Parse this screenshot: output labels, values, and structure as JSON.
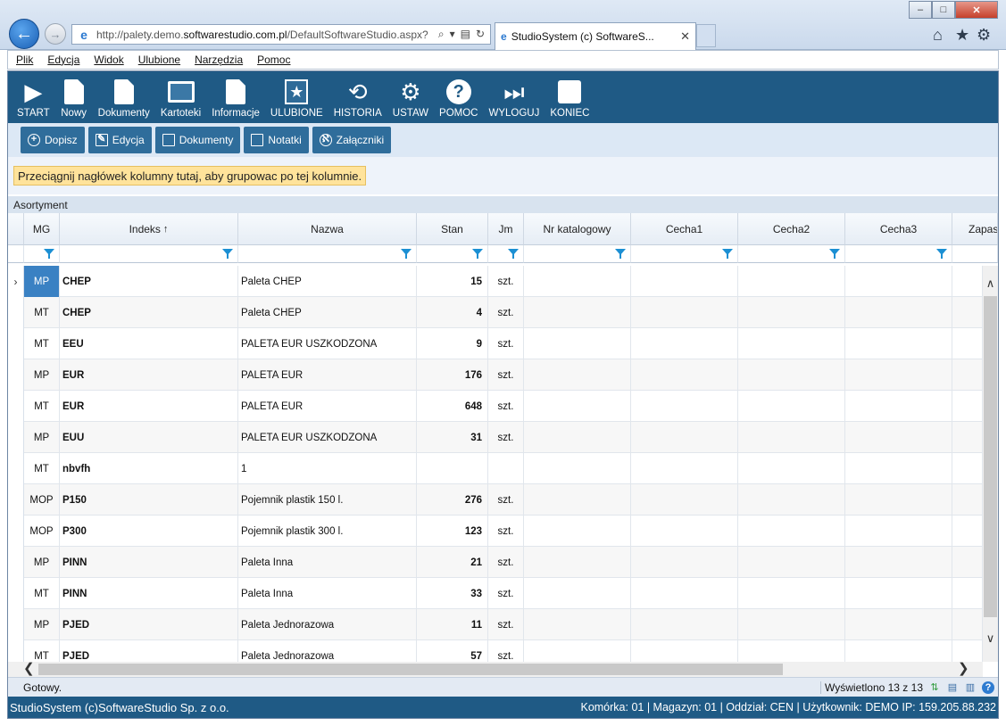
{
  "browser": {
    "url_prefix": "http://paletу.demo.",
    "url_host": "softwarestudio.com.pl",
    "url_path": "/DefaultSoftwareStudio.aspx?",
    "tab_title": "StudioSystem (c) SoftwareS..."
  },
  "menu": [
    "Plik",
    "Edycja",
    "Widok",
    "Ulubione",
    "Narzędzia",
    "Pomoc"
  ],
  "ribbon": [
    {
      "label": "START",
      "icon": "play-icon"
    },
    {
      "label": "Nowy",
      "icon": "new-document-icon"
    },
    {
      "label": "Dokumenty",
      "icon": "documents-icon"
    },
    {
      "label": "Kartoteki",
      "icon": "card-files-icon"
    },
    {
      "label": "Informacje",
      "icon": "info-icon"
    },
    {
      "label": "ULUBIONE",
      "icon": "favorites-icon"
    },
    {
      "label": "HISTORIA",
      "icon": "history-icon"
    },
    {
      "label": "USTAW",
      "icon": "settings-icon"
    },
    {
      "label": "POMOC",
      "icon": "help-icon"
    },
    {
      "label": "WYLOGUJ",
      "icon": "logout-icon"
    },
    {
      "label": "KONIEC",
      "icon": "end-icon"
    }
  ],
  "toolbar": [
    {
      "label": "Dopisz",
      "icon": "add-icon"
    },
    {
      "label": "Edycja",
      "icon": "edit-icon"
    },
    {
      "label": "Dokumenty",
      "icon": "document-icon"
    },
    {
      "label": "Notatki",
      "icon": "notes-icon"
    },
    {
      "label": "Załączniki",
      "icon": "attachment-icon"
    }
  ],
  "group_hint": "Przeciągnij nagłówek kolumny tutaj, aby grupowac po tej kolumnie.",
  "grid": {
    "title": "Asortyment",
    "columns": [
      "MG",
      "Indeks",
      "Nazwa",
      "Stan",
      "Jm",
      "Nr katalogowy",
      "Cecha1",
      "Cecha2",
      "Cecha3",
      "Zapas"
    ],
    "sort_column": "Indeks",
    "sort_direction": "ascending",
    "rows": [
      {
        "mg": "MP",
        "indeks": "CHEP",
        "nazwa": "Paleta CHEP",
        "stan": "15",
        "jm": "szt."
      },
      {
        "mg": "MT",
        "indeks": "CHEP",
        "nazwa": "Paleta CHEP",
        "stan": "4",
        "jm": "szt."
      },
      {
        "mg": "MT",
        "indeks": "EEU",
        "nazwa": "PALETA EUR USZKODZONA",
        "stan": "9",
        "jm": "szt."
      },
      {
        "mg": "MP",
        "indeks": "EUR",
        "nazwa": "PALETA EUR",
        "stan": "176",
        "jm": "szt."
      },
      {
        "mg": "MT",
        "indeks": "EUR",
        "nazwa": "PALETA EUR",
        "stan": "648",
        "jm": "szt."
      },
      {
        "mg": "MP",
        "indeks": "EUU",
        "nazwa": "PALETA EUR USZKODZONA",
        "stan": "31",
        "jm": "szt."
      },
      {
        "mg": "MT",
        "indeks": "nbvfh",
        "nazwa": "1",
        "stan": "",
        "jm": ""
      },
      {
        "mg": "MOP",
        "indeks": "P150",
        "nazwa": "Pojemnik plastik 150 l.",
        "stan": "276",
        "jm": "szt."
      },
      {
        "mg": "MOP",
        "indeks": "P300",
        "nazwa": "Pojemnik plastik 300 l.",
        "stan": "123",
        "jm": "szt."
      },
      {
        "mg": "MP",
        "indeks": "PINN",
        "nazwa": "Paleta Inna",
        "stan": "21",
        "jm": "szt."
      },
      {
        "mg": "MT",
        "indeks": "PINN",
        "nazwa": "Paleta Inna",
        "stan": "33",
        "jm": "szt."
      },
      {
        "mg": "MP",
        "indeks": "PJED",
        "nazwa": "Paleta Jednorazowa",
        "stan": "11",
        "jm": "szt."
      },
      {
        "mg": "MT",
        "indeks": "PJED",
        "nazwa": "Paleta Jednorazowa",
        "stan": "57",
        "jm": "szt."
      }
    ]
  },
  "status": {
    "left": "Gotowy.",
    "count": "Wyświetlono 13 z 13"
  },
  "footer": {
    "left": "StudioSystem (c)SoftwareStudio Sp. z o.o.",
    "right": "Komórka: 01 | Magazyn: 01 | Oddział: CEN | Użytkownik: DEMO IP: 159.205.88.232"
  },
  "colors": {
    "ribbon": "#1f5a85",
    "selected": "#3a81c3",
    "hint": "#ffe39b"
  }
}
